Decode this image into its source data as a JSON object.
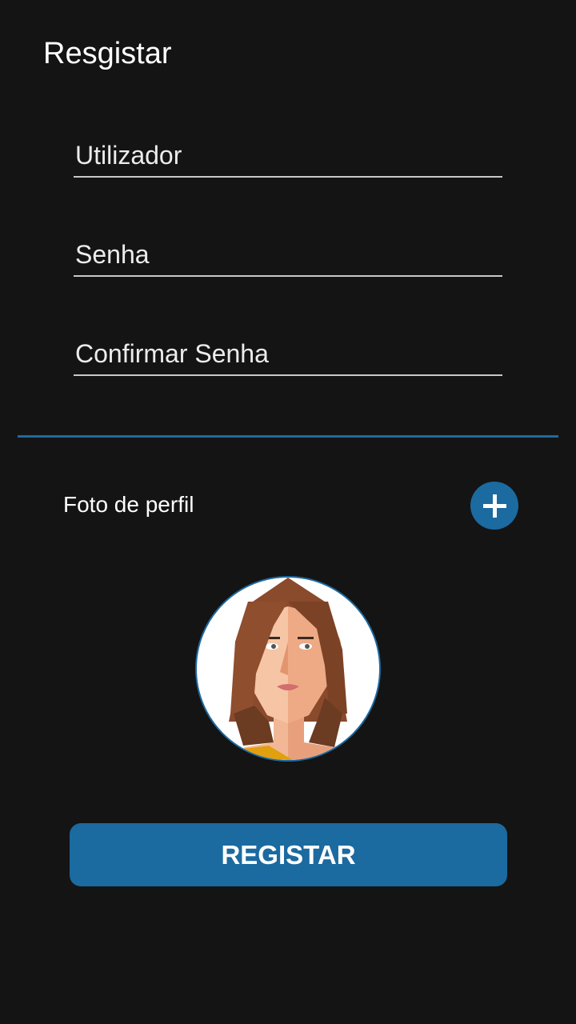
{
  "header": {
    "title": "Resgistar"
  },
  "form": {
    "username_placeholder": "Utilizador",
    "password_placeholder": "Senha",
    "confirm_password_placeholder": "Confirmar Senha"
  },
  "profile": {
    "label": "Foto de perfil",
    "add_icon": "plus-icon",
    "avatar_icon": "woman-avatar"
  },
  "actions": {
    "register_label": "REGISTAR"
  },
  "colors": {
    "background": "#141414",
    "accent": "#1b6aa0",
    "underline": "#c8c8c8",
    "text": "#ffffff"
  }
}
